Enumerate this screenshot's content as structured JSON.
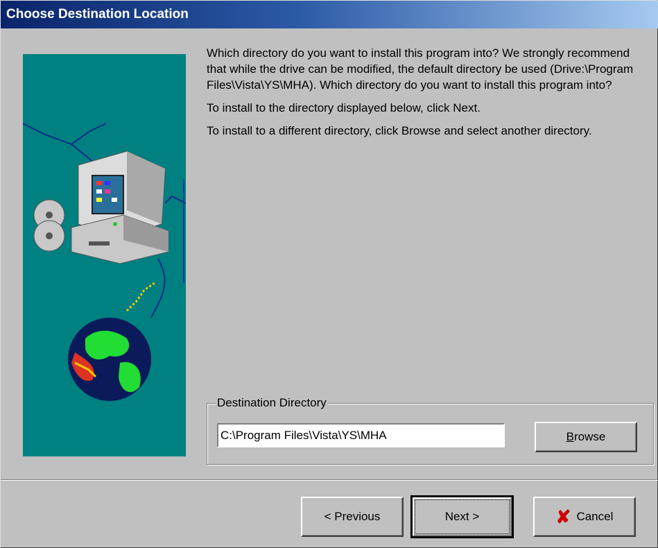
{
  "window": {
    "title": "Choose Destination Location"
  },
  "description": {
    "paragraph1": "Which directory do you want to install this program into? We strongly recommend that while the drive can be modified, the default directory be used (Drive:\\Program Files\\Vista\\YS\\MHA). Which directory do you want to install this program into?",
    "paragraph2": "To install to the directory displayed below, click Next.",
    "paragraph3": "To install to a different directory, click Browse and select another directory."
  },
  "destination": {
    "group_label": "Destination Directory",
    "path_value": "C:\\Program Files\\Vista\\YS\\MHA",
    "browse_label": "Browse",
    "browse_mnemonic": "B",
    "browse_rest": "rowse"
  },
  "buttons": {
    "previous_label": "< Previous",
    "next_label": "Next >",
    "cancel_label": "Cancel",
    "cancel_icon": "red-x-icon"
  },
  "colors": {
    "titlebar_start": "#0a246a",
    "titlebar_end": "#a6caf0",
    "panel_background": "#008080",
    "dialog_background": "#c0c0c0",
    "cancel_icon": "#cc0000"
  }
}
